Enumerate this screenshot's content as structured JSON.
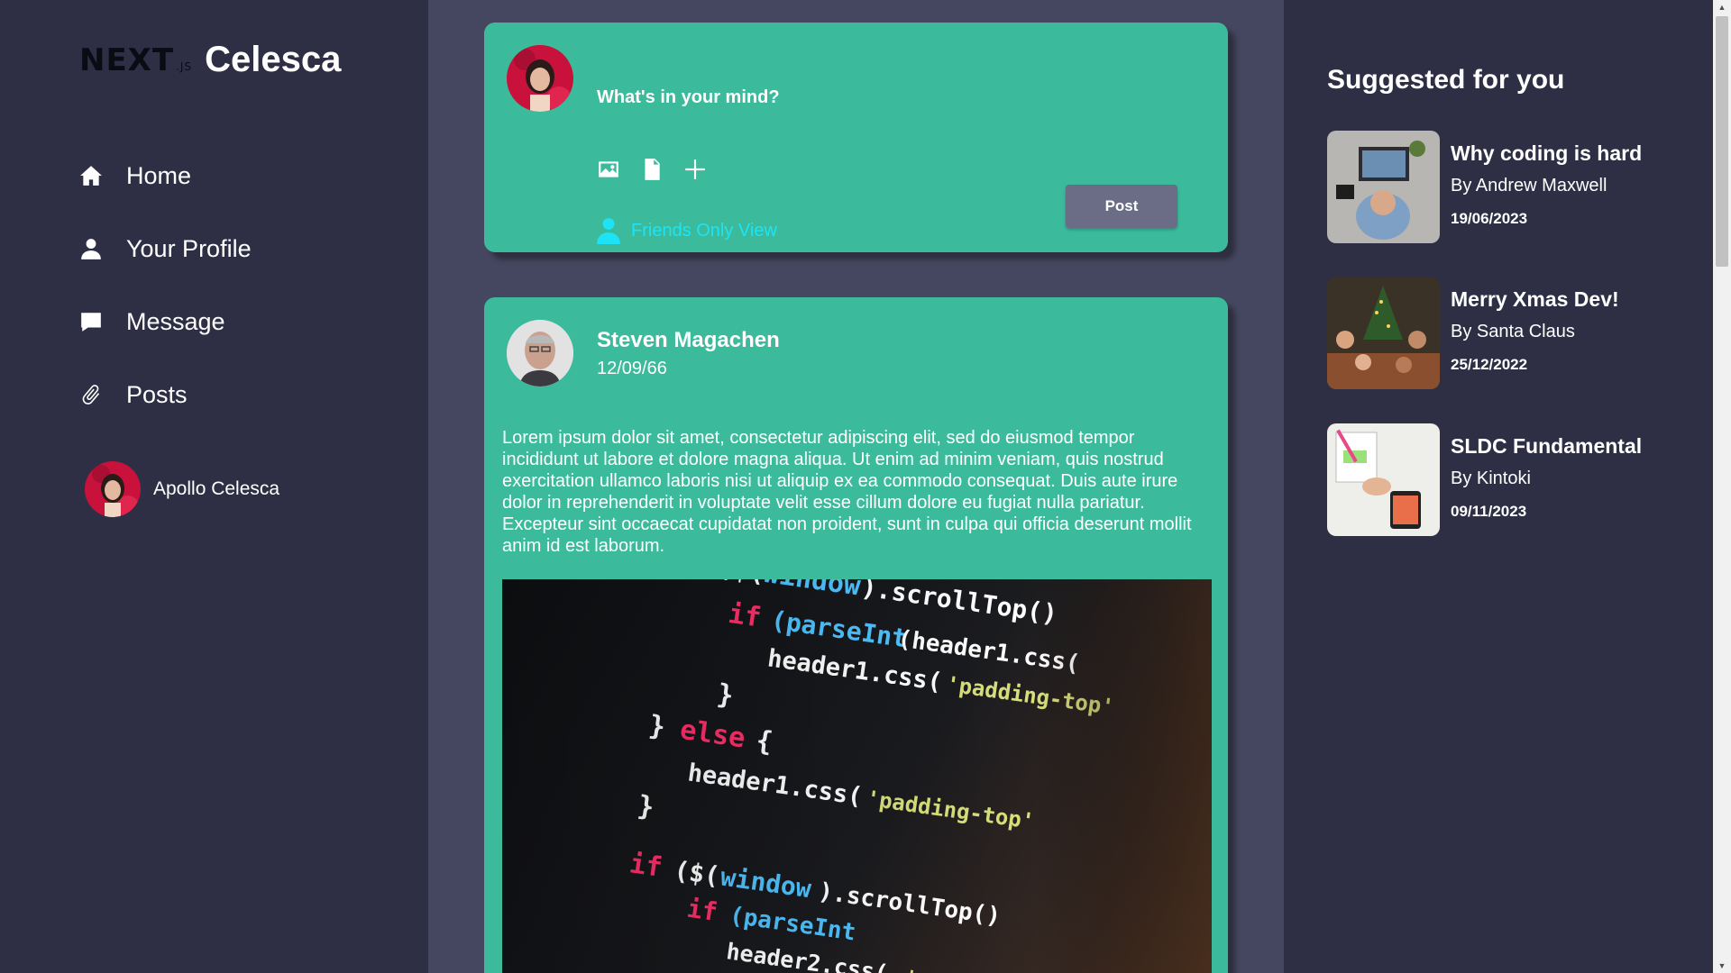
{
  "brand": {
    "logo_text": "NEXT",
    "logo_suffix": ".JS",
    "title": "Celesca"
  },
  "nav": [
    {
      "label": "Home",
      "icon": "home-icon"
    },
    {
      "label": "Your Profile",
      "icon": "user-icon"
    },
    {
      "label": "Message",
      "icon": "message-icon"
    },
    {
      "label": "Posts",
      "icon": "paperclip-icon"
    }
  ],
  "current_user": {
    "name": "Apollo Celesca"
  },
  "composer": {
    "prompt": "What's in your mind?",
    "visibility_label": "Friends Only View",
    "post_label": "Post",
    "tools": [
      "image-icon",
      "file-icon",
      "plus-icon"
    ]
  },
  "post": {
    "author": "Steven Magachen",
    "date": "12/09/66",
    "body": "Lorem ipsum dolor sit amet, consectetur adipiscing elit, sed do eiusmod tempor incididunt ut labore et dolore magna aliqua. Ut enim ad minim veniam, quis nostrud exercitation ullamco laboris nisi ut aliquip ex ea commodo consequat. Duis aute irure dolor in reprehenderit in voluptate velit esse cillum dolore eu fugiat nulla pariatur. Excepteur sint occaecat cupidatat non proident, sunt in culpa qui officia deserunt mollit anim id est laborum."
  },
  "suggested": {
    "heading": "Suggested for you",
    "items": [
      {
        "title": "Why coding is hard",
        "author": "By Andrew Maxwell",
        "date": "19/06/2023"
      },
      {
        "title": "Merry Xmas Dev!",
        "author": "By Santa Claus",
        "date": "25/12/2022"
      },
      {
        "title": "SLDC Fundamental",
        "author": "By Kintoki",
        "date": "09/11/2023"
      }
    ]
  },
  "colors": {
    "sidebar_bg": "#2e2f45",
    "feed_bg": "#454760",
    "card_bg": "#3bbb9c",
    "accent_cyan": "#1ee3f6",
    "button_bg": "#6b6d86"
  }
}
